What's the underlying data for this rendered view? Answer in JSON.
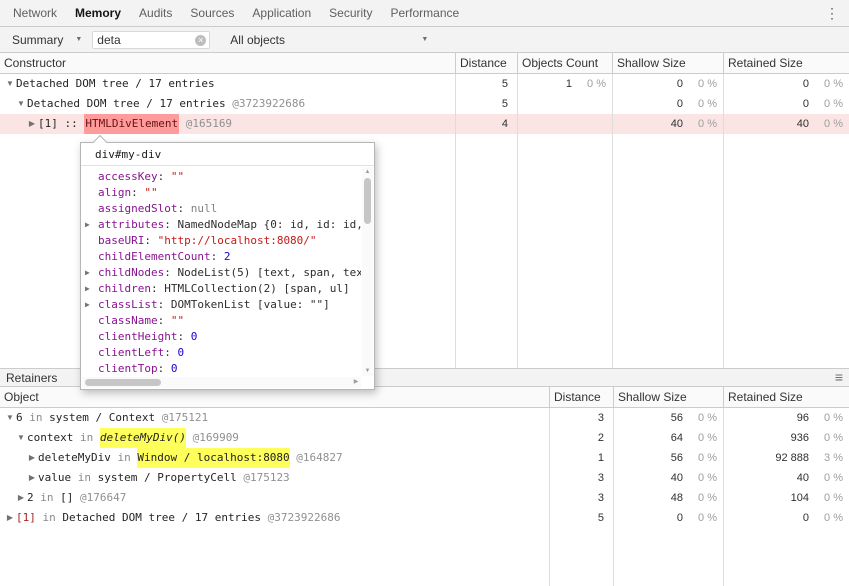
{
  "icons": {
    "overflow_menu": "⋮",
    "dropdown_arrow": "▼",
    "clear_filter": "×",
    "hamburger_lines": "≡",
    "scroll_up": "▲",
    "scroll_down": "▼",
    "scroll_right": "▶"
  },
  "strings": {
    "in_separator": " in ",
    "colon_separator": ": "
  },
  "colors": {
    "match_highlight": "#ff9b9b",
    "selected_row": "#fbe4e4",
    "retainer_highlight": "#ffff5c",
    "property_name": "#881391",
    "string_value": "#c41a16",
    "number_value": "#1c00cf"
  },
  "tabs": [
    {
      "label": "Network"
    },
    {
      "label": "Memory"
    },
    {
      "label": "Audits"
    },
    {
      "label": "Sources"
    },
    {
      "label": "Application"
    },
    {
      "label": "Security"
    },
    {
      "label": "Performance"
    }
  ],
  "toolbar": {
    "perspective": "Summary",
    "filter_value": "deta",
    "class_filter": "All objects"
  },
  "constructor_grid": {
    "columns": [
      "Constructor",
      "Distance",
      "Objects Count",
      "Shallow Size",
      "Retained Size"
    ],
    "rows": [
      {
        "expander": "▼",
        "name": "Detached DOM tree / 17 entries",
        "id": "",
        "distance": "5",
        "count": "1",
        "count_pct": "0 %",
        "shallow": "0",
        "shallow_pct": "0 %",
        "retained": "0",
        "retained_pct": "0 %"
      },
      {
        "expander": "▼",
        "name": "Detached DOM tree / 17 entries",
        "id": " @3723922686",
        "distance": "5",
        "count": "",
        "count_pct": "",
        "shallow": "0",
        "shallow_pct": "0 %",
        "retained": "0",
        "retained_pct": "0 %"
      },
      {
        "expander": "▶",
        "prefix": "[1] :: ",
        "match": "HTMLDivElement",
        "id": " @165169",
        "distance": "4",
        "count": "",
        "count_pct": "",
        "shallow": "40",
        "shallow_pct": "0 %",
        "retained": "40",
        "retained_pct": "0 %"
      }
    ]
  },
  "preview_popup": {
    "title": "div#my-div",
    "properties": [
      {
        "expander": "",
        "label": "accessKey",
        "value": "\"\""
      },
      {
        "expander": "",
        "label": "align",
        "value": "\"\""
      },
      {
        "expander": "",
        "label": "assignedSlot",
        "value": "null"
      },
      {
        "expander": "▶",
        "label": "attributes",
        "value": "NamedNodeMap {0: id, id: id,"
      },
      {
        "expander": "",
        "label": "baseURI",
        "value": "\"http://localhost:8080/\""
      },
      {
        "expander": "",
        "label": "childElementCount",
        "value": "2"
      },
      {
        "expander": "▶",
        "label": "childNodes",
        "value": "NodeList(5) [text, span, tex"
      },
      {
        "expander": "▶",
        "label": "children",
        "value": "HTMLCollection(2) [span, ul]"
      },
      {
        "expander": "▶",
        "label": "classList",
        "value": "DOMTokenList [value: \"\"]"
      },
      {
        "expander": "",
        "label": "className",
        "value": "\"\""
      },
      {
        "expander": "",
        "label": "clientHeight",
        "value": "0"
      },
      {
        "expander": "",
        "label": "clientLeft",
        "value": "0"
      },
      {
        "expander": "",
        "label": "clientTop",
        "value": "0"
      }
    ]
  },
  "retainers": {
    "title": "Retainers",
    "columns": [
      "Object",
      "Distance",
      "Shallow Size",
      "Retained Size"
    ],
    "rows": [
      {
        "expander": "▼",
        "edge": "6",
        "object": "system / Context",
        "id": " @175121",
        "distance": "3",
        "shallow": "56",
        "shallow_pct": "0 %",
        "retained": "96",
        "retained_pct": "0 %"
      },
      {
        "expander": "▼",
        "edge": "context",
        "object": "deleteMyDiv()",
        "id": " @169909",
        "distance": "2",
        "shallow": "64",
        "shallow_pct": "0 %",
        "retained": "936",
        "retained_pct": "0 %"
      },
      {
        "expander": "▶",
        "edge": "deleteMyDiv",
        "object": "Window / localhost:8080",
        "id": " @164827",
        "distance": "1",
        "shallow": "56",
        "shallow_pct": "0 %",
        "retained": "92 888",
        "retained_pct": "3 %"
      },
      {
        "expander": "▶",
        "edge": "value",
        "object": "system / PropertyCell",
        "id": " @175123",
        "distance": "3",
        "shallow": "40",
        "shallow_pct": "0 %",
        "retained": "40",
        "retained_pct": "0 %"
      },
      {
        "expander": "▶",
        "edge": "2",
        "object": "[]",
        "id": " @176647",
        "distance": "3",
        "shallow": "48",
        "shallow_pct": "0 %",
        "retained": "104",
        "retained_pct": "0 %"
      },
      {
        "expander": "▶",
        "edge": "[1]",
        "object": "Detached DOM tree / 17 entries",
        "id": " @3723922686",
        "distance": "5",
        "shallow": "0",
        "shallow_pct": "0 %",
        "retained": "0",
        "retained_pct": "0 %"
      }
    ]
  }
}
